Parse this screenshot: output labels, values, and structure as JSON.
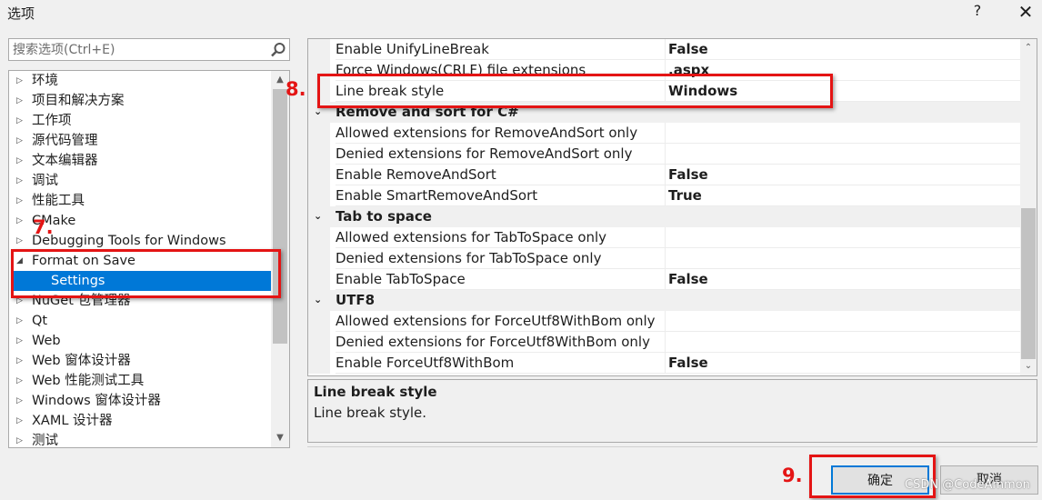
{
  "window": {
    "title": "选项",
    "help_label": "?",
    "close_label": "✕"
  },
  "search": {
    "placeholder": "搜索选项(Ctrl+E)"
  },
  "tree": {
    "items": [
      {
        "label": "环境",
        "arrow": "▷"
      },
      {
        "label": "项目和解决方案",
        "arrow": "▷"
      },
      {
        "label": "工作项",
        "arrow": "▷"
      },
      {
        "label": "源代码管理",
        "arrow": "▷"
      },
      {
        "label": "文本编辑器",
        "arrow": "▷"
      },
      {
        "label": "调试",
        "arrow": "▷"
      },
      {
        "label": "性能工具",
        "arrow": "▷"
      },
      {
        "label": "CMake",
        "arrow": "▷"
      },
      {
        "label": "Debugging Tools for Windows",
        "arrow": "▷"
      },
      {
        "label": "Format on Save",
        "arrow": "◢"
      },
      {
        "label": "Settings",
        "arrow": ""
      },
      {
        "label": "NuGet 包管理器",
        "arrow": "▷"
      },
      {
        "label": "Qt",
        "arrow": "▷"
      },
      {
        "label": "Web",
        "arrow": "▷"
      },
      {
        "label": "Web 窗体设计器",
        "arrow": "▷"
      },
      {
        "label": "Web 性能测试工具",
        "arrow": "▷"
      },
      {
        "label": "Windows 窗体设计器",
        "arrow": "▷"
      },
      {
        "label": "XAML 设计器",
        "arrow": "▷"
      },
      {
        "label": "测试",
        "arrow": "▷"
      }
    ]
  },
  "grid": {
    "rows": [
      {
        "kind": "prop",
        "name": "Enable UnifyLineBreak",
        "value": "False"
      },
      {
        "kind": "prop",
        "name": "Force Windows(CRLF) file extensions",
        "value": ".aspx"
      },
      {
        "kind": "prop",
        "name": "Line break style",
        "value": "Windows"
      },
      {
        "kind": "cat",
        "name": "Remove and sort for C#",
        "chev": "⌄"
      },
      {
        "kind": "prop",
        "name": "Allowed extensions for RemoveAndSort only",
        "value": ""
      },
      {
        "kind": "prop",
        "name": "Denied extensions for RemoveAndSort only",
        "value": ""
      },
      {
        "kind": "prop",
        "name": "Enable RemoveAndSort",
        "value": "False"
      },
      {
        "kind": "prop",
        "name": "Enable SmartRemoveAndSort",
        "value": "True"
      },
      {
        "kind": "cat",
        "name": "Tab to space",
        "chev": "⌄"
      },
      {
        "kind": "prop",
        "name": "Allowed extensions for TabToSpace only",
        "value": ""
      },
      {
        "kind": "prop",
        "name": "Denied extensions for TabToSpace only",
        "value": ""
      },
      {
        "kind": "prop",
        "name": "Enable TabToSpace",
        "value": "False"
      },
      {
        "kind": "cat",
        "name": "UTF8",
        "chev": "⌄"
      },
      {
        "kind": "prop",
        "name": "Allowed extensions for ForceUtf8WithBom only",
        "value": ""
      },
      {
        "kind": "prop",
        "name": "Denied extensions for ForceUtf8WithBom only",
        "value": ""
      },
      {
        "kind": "prop",
        "name": "Enable ForceUtf8WithBom",
        "value": "False"
      }
    ]
  },
  "description": {
    "title": "Line break style",
    "text": "Line break style."
  },
  "buttons": {
    "ok": "确定",
    "cancel": "取消"
  },
  "annotations": {
    "step7": "7.",
    "step8": "8.",
    "step9": "9.",
    "color": "#e41414"
  },
  "watermark": "CSDN @CodeAmmon",
  "colors": {
    "selection": "#0078d7",
    "window_bg": "#f0f0f0"
  }
}
